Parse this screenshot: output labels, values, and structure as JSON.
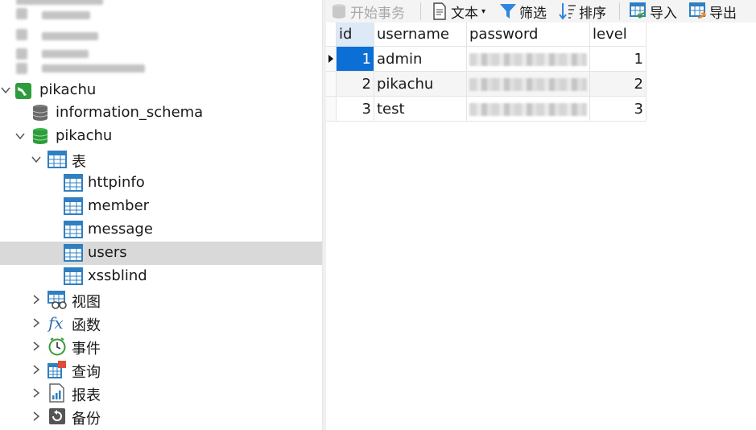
{
  "navigator": {
    "connection": "pikachu",
    "databases": {
      "information_schema": "information_schema",
      "pikachu": "pikachu"
    },
    "tables_folder": "表",
    "tables": [
      "httpinfo",
      "member",
      "message",
      "users",
      "xssblind"
    ],
    "selected_table": "users",
    "folders": [
      "视图",
      "函数",
      "事件",
      "查询",
      "报表",
      "备份"
    ]
  },
  "toolbar": {
    "begin_transaction": "开始事务",
    "text": "文本",
    "filter": "筛选",
    "sort": "排序",
    "import": "导入",
    "export": "导出"
  },
  "grid": {
    "columns": [
      "id",
      "username",
      "password",
      "level"
    ],
    "rows": [
      {
        "id": "1",
        "username": "admin",
        "level": "1"
      },
      {
        "id": "2",
        "username": "pikachu",
        "level": "2"
      },
      {
        "id": "3",
        "username": "test",
        "level": "3"
      }
    ]
  },
  "colors": {
    "selection": "#0b6fd6",
    "row_selected": "#d9d9d9",
    "db_green": "#2e9c3a",
    "table_icon": "#2f7fc1"
  }
}
